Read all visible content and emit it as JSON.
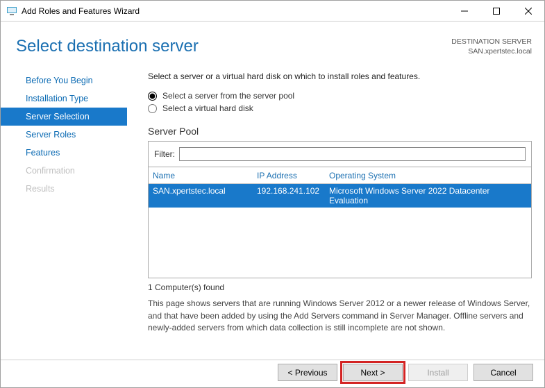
{
  "titlebar": {
    "title": "Add Roles and Features Wizard"
  },
  "header": {
    "title": "Select destination server",
    "dest_label": "DESTINATION SERVER",
    "dest_value": "SAN.xpertstec.local"
  },
  "nav": {
    "items": [
      {
        "label": "Before You Begin",
        "state": "normal"
      },
      {
        "label": "Installation Type",
        "state": "normal"
      },
      {
        "label": "Server Selection",
        "state": "active"
      },
      {
        "label": "Server Roles",
        "state": "normal"
      },
      {
        "label": "Features",
        "state": "normal"
      },
      {
        "label": "Confirmation",
        "state": "disabled"
      },
      {
        "label": "Results",
        "state": "disabled"
      }
    ]
  },
  "content": {
    "intro": "Select a server or a virtual hard disk on which to install roles and features.",
    "radio_pool": "Select a server from the server pool",
    "radio_vhd": "Select a virtual hard disk",
    "section_title": "Server Pool",
    "filter_label": "Filter:",
    "filter_value": "",
    "columns": {
      "name": "Name",
      "ip": "IP Address",
      "os": "Operating System"
    },
    "rows": [
      {
        "name": "SAN.xpertstec.local",
        "ip": "192.168.241.102",
        "os": "Microsoft Windows Server 2022 Datacenter Evaluation",
        "selected": true
      }
    ],
    "found": "1 Computer(s) found",
    "note": "This page shows servers that are running Windows Server 2012 or a newer release of Windows Server, and that have been added by using the Add Servers command in Server Manager. Offline servers and newly-added servers from which data collection is still incomplete are not shown."
  },
  "footer": {
    "previous": "< Previous",
    "next": "Next >",
    "install": "Install",
    "cancel": "Cancel"
  }
}
